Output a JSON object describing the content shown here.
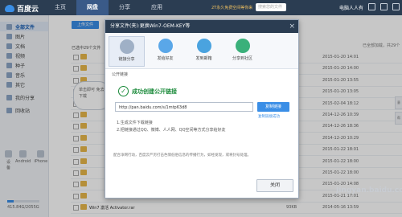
{
  "app": {
    "name": "百度云"
  },
  "nav": {
    "tabs": [
      "主页",
      "网盘",
      "分享",
      "应用"
    ],
    "active": "网盘"
  },
  "promo": "2T永久免费空间等你来",
  "search_placeholder": "搜索您的文件",
  "user": "电脑人人有",
  "sidebar": {
    "items": [
      "全部文件",
      "图片",
      "文档",
      "视频",
      "种子",
      "音乐",
      "其它",
      "我的分享",
      "回收站"
    ],
    "devices": [
      "设备",
      "Android",
      "iPhone",
      "更多"
    ],
    "quota": "415.84G/2055G",
    "quota_fraction": 0.2
  },
  "toolbar": {
    "upload_label": "上传文件"
  },
  "list": {
    "header": "已选中29个文件",
    "meta": "已全部加载，共29个",
    "rows": [
      {
        "name": "",
        "size": "",
        "date": "2015-01-20 14:01"
      },
      {
        "name": "",
        "size": "",
        "date": "2015-01-20 14:00"
      },
      {
        "name": "",
        "size": "",
        "date": "2015-01-20 13:55"
      },
      {
        "name": "",
        "size": "",
        "date": "2015-01-20 13:05"
      },
      {
        "name": "",
        "size": "",
        "date": "2015-02-04 18:12"
      },
      {
        "name": "",
        "size": "",
        "date": "2014-12-26 10:39"
      },
      {
        "name": "",
        "size": "",
        "date": "2014-12-26 18:36"
      },
      {
        "name": "",
        "size": "",
        "date": "2014-12-20 10:29"
      },
      {
        "name": "",
        "size": "",
        "date": "2015-01-22 18:01"
      },
      {
        "name": "",
        "size": "",
        "date": "2015-01-22 18:00"
      },
      {
        "name": "",
        "size": "",
        "date": "2015-01-22 18:00"
      },
      {
        "name": "",
        "size": "",
        "date": "2015-01-20 14:08"
      },
      {
        "name": "",
        "size": "",
        "date": "2015-01-21 17:01"
      },
      {
        "name": "Win7 激活 Activator.rar",
        "size": "93KB",
        "date": "2014-05-16 13:59"
      }
    ]
  },
  "bubble_text": "单击即可\n免去下载",
  "dialog": {
    "title": "分享文件(夹):更换Win7-OEM-KEY等",
    "close": "×",
    "tabs": [
      "链接分享",
      "发给好友",
      "发到邮箱",
      "分享到社区"
    ],
    "section_label": "公开链接",
    "success": "成功创建公开链接",
    "link": "http://pan.baidu.com/s/1mtp63d8",
    "copy_button": "复制链接",
    "copy_tip": "复制链接成功",
    "tips": [
      "1.生成文件下载链接",
      "2.把链接通过QQ、微博、人人网、QQ空间等方式分享给好友"
    ],
    "footnote": "配合净网行动，百度云严厉打击色情低俗信息的传播行为，如经发现，或将封号处理。",
    "close_button": "关闭"
  },
  "watermark": "Jingyan.baidu.com",
  "colors": {
    "accent": "#3a8ee6",
    "topbar": "#2b3d52",
    "success": "#1a8a3a"
  }
}
